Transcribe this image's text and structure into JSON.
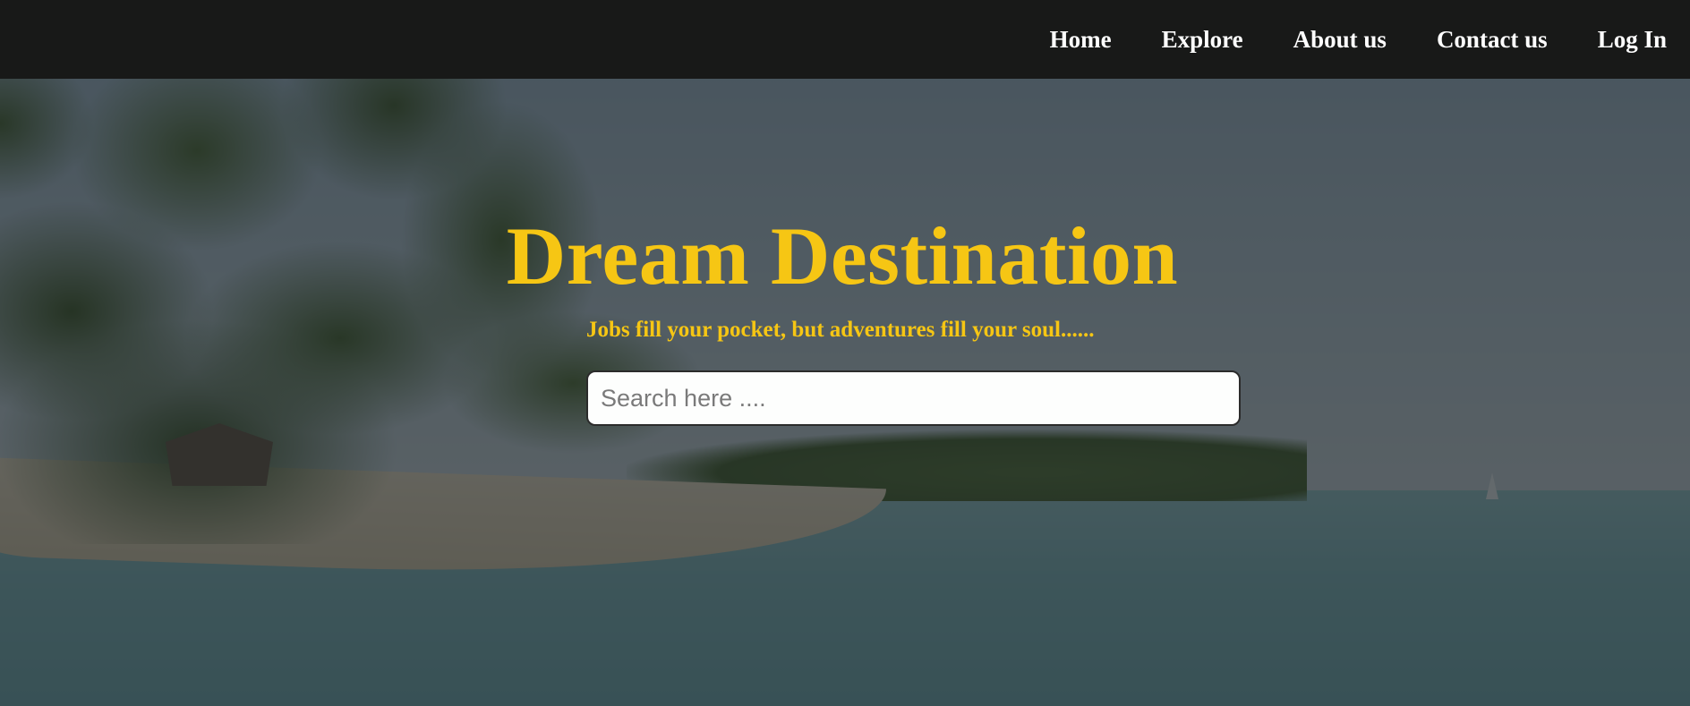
{
  "header": {
    "nav": [
      {
        "label": "Home"
      },
      {
        "label": "Explore"
      },
      {
        "label": "About us"
      },
      {
        "label": "Contact us"
      },
      {
        "label": "Log In"
      }
    ]
  },
  "hero": {
    "title": "Dream Destination",
    "tagline": "Jobs fill your pocket, but adventures fill your soul......",
    "search": {
      "value": "",
      "placeholder": "Search here ...."
    }
  },
  "colors": {
    "navbar_bg": "#181918",
    "nav_text": "#ffffff",
    "accent_yellow": "#f6c614",
    "overlay": "rgba(30,36,40,0.66)",
    "search_bg": "#fdfefd"
  }
}
